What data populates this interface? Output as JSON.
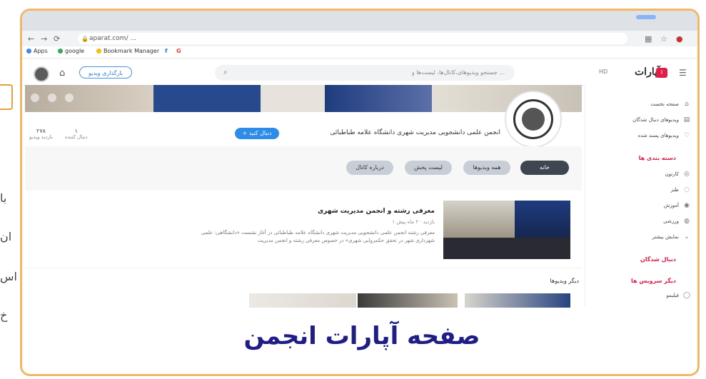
{
  "side": {
    "lines": [
      "با",
      "ان",
      "اس",
      "خ"
    ]
  },
  "browser": {
    "url": "aparat.com/ ...",
    "nav": [
      "←",
      "→",
      "⟳"
    ],
    "bookmarks": [
      {
        "label": "Apps",
        "color": "#4285f4"
      },
      {
        "label": "google",
        "color": "#34a853"
      },
      {
        "label": "Bookmark Manager",
        "color": "#fbbc05"
      },
      {
        "label": "f",
        "color": "#1877f2"
      },
      {
        "label": "G",
        "color": "#ea4335"
      }
    ]
  },
  "topbar": {
    "upload_label": "بارگذاری ویدیو",
    "search_placeholder": "جستجو ویدیوهای،کانال‌ها، لیست‌ها و ...",
    "hd_label": "HD",
    "logo": "آپارات"
  },
  "channel": {
    "name": "انجمن علمی دانشجویی مدیریت شهری دانشگاه علامه طباطبائی",
    "follow_label": "+ دنبال کنید",
    "stats": [
      {
        "value": "۲۷۸",
        "label": "بازدید ویدیو"
      },
      {
        "value": "۱",
        "label": "دنبال کننده"
      }
    ]
  },
  "tabs": [
    {
      "label": "خانه",
      "active": true
    },
    {
      "label": "همه ویدیوها",
      "active": false
    },
    {
      "label": "لیست پخش",
      "active": false
    },
    {
      "label": "درباره کانال",
      "active": false
    }
  ],
  "featured_video": {
    "title": "معرفی رشته و انجمن مدیریت شهری",
    "meta": "۱ بازدید · ۲ ماه پیش",
    "description": "معرفی رشته انجمن علمی دانشجویی مدیریت شهری دانشگاه علامه طباطبائی در آغاز نشست «دانشگاهی: علمی شهرداری شهر در تحقق حکمروایی شهری» در خصوص معرفی رشته و انجمن مدیریت"
  },
  "other_videos": {
    "title": "دیگر ویدیوها"
  },
  "sidebar": {
    "items": [
      {
        "label": "صفحه نخست",
        "icon": "⌂"
      },
      {
        "label": "ویدیوهای دنبال شدگان",
        "icon": "▤"
      },
      {
        "label": "ویدیوهای پسند شده",
        "icon": "♡"
      }
    ],
    "categories_head": "دسته بندی ها",
    "categories": [
      {
        "label": "کارتون",
        "icon": "◎"
      },
      {
        "label": "طنز",
        "icon": "◌"
      },
      {
        "label": "آموزش",
        "icon": "◉"
      },
      {
        "label": "ورزشی",
        "icon": "◍"
      },
      {
        "label": "نمایش بیشتر",
        "icon": "⌄"
      }
    ],
    "followers_head": "دنبال شدگان",
    "services_head": "دیگر سرویس ها",
    "services": [
      {
        "label": "فیلیمو",
        "icon": "◯"
      }
    ]
  },
  "caption": "صفحه آپارات انجمن",
  "colors": {
    "frame": "#f3b867",
    "accent_blue": "#2d8ce8",
    "brand_red": "#e11d48",
    "caption": "#1f1d86"
  }
}
